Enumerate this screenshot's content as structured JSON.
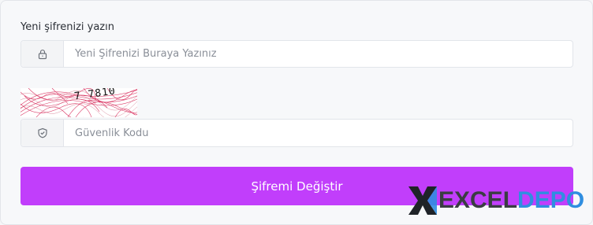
{
  "form": {
    "label": "Yeni şifrenizi yazın",
    "password_placeholder": "Yeni Şifrenizi Buraya Yazınız",
    "password_icon": "lock-icon",
    "captcha_text": "7 7810",
    "code_placeholder": "Güvenlik Kodu",
    "code_icon": "shield-check-icon",
    "submit_label": "Şifremi Değiştir"
  },
  "watermark": {
    "text_excel": "EXCEL",
    "text_depo": "DEPO"
  },
  "colors": {
    "accent": "#c13efb",
    "captcha_lines": "#d4154a"
  }
}
